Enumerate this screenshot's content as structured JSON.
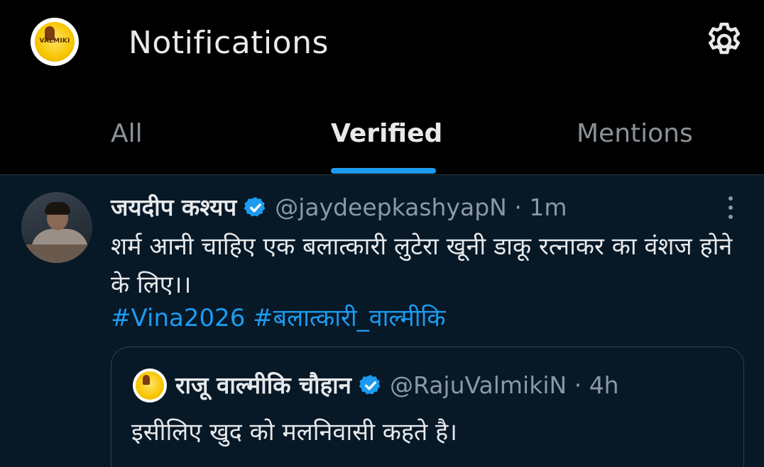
{
  "header": {
    "title": "Notifications",
    "profile_logo_text": "VALMIKI",
    "settings_icon": "gear-icon"
  },
  "tabs": [
    {
      "label": "All",
      "active": false
    },
    {
      "label": "Verified",
      "active": true
    },
    {
      "label": "Mentions",
      "active": false
    }
  ],
  "colors": {
    "accent": "#1d9bf0",
    "background": "#000000",
    "feed_background": "#071827",
    "muted_text": "#8b98a5"
  },
  "notification": {
    "author_name": "जयदीप कश्यप",
    "author_handle": "@jaydeepkashyapN",
    "separator": "·",
    "time": "1m",
    "verified": true,
    "text": "शर्म आनी चाहिए एक बलात्कारी लुटेरा खूनी डाकू रत्नाकर का वंशज होने के लिए।।",
    "hashtags": [
      "#Vina2026",
      "#बलात्कारी_वाल्मीकि"
    ],
    "more_icon": "more-vertical-icon",
    "quoted": {
      "author_name": "राजू वाल्मीकि चौहान",
      "author_handle": "@RajuValmikiN",
      "separator": "·",
      "time": "4h",
      "verified": true,
      "text": "इसीलिए खुद को मलनिवासी कहते है।"
    }
  }
}
